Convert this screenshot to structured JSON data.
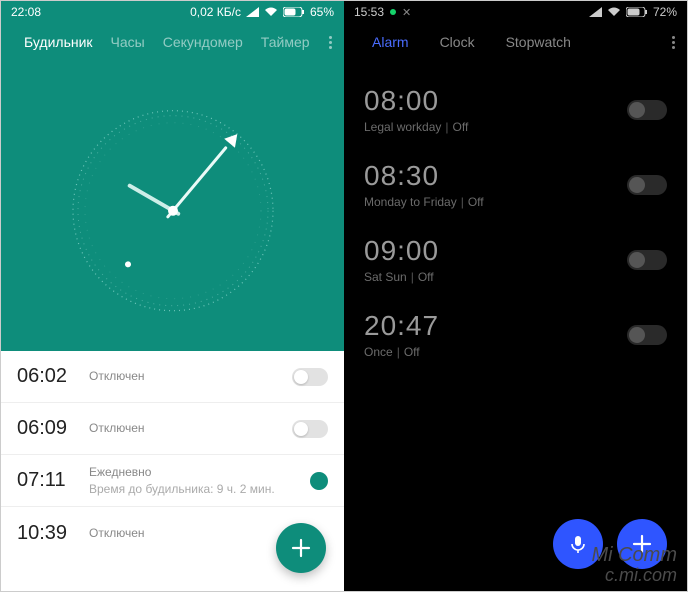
{
  "left": {
    "status": {
      "time": "22:08",
      "speed": "0,02 КБ/с",
      "battery": "65%"
    },
    "tabs": [
      "Будильник",
      "Часы",
      "Секундомер",
      "Таймер"
    ],
    "active_tab_index": 0,
    "alarms": [
      {
        "time": "06:02",
        "label": "Отключен",
        "sub": "",
        "on": false,
        "toggle_style": "switch"
      },
      {
        "time": "06:09",
        "label": "Отключен",
        "sub": "",
        "on": false,
        "toggle_style": "switch"
      },
      {
        "time": "07:11",
        "label": "Ежедневно",
        "sub": "Время до будильника: 9 ч. 2 мин.",
        "on": true,
        "toggle_style": "radio"
      },
      {
        "time": "10:39",
        "label": "Отключен",
        "sub": "",
        "on": false,
        "toggle_style": "none"
      }
    ]
  },
  "right": {
    "status": {
      "time": "15:53",
      "battery": "72%"
    },
    "tabs": [
      "Alarm",
      "Clock",
      "Stopwatch"
    ],
    "active_tab_index": 0,
    "alarms": [
      {
        "time": "08:00",
        "desc": "Legal workday",
        "state": "Off"
      },
      {
        "time": "08:30",
        "desc": "Monday to Friday",
        "state": "Off"
      },
      {
        "time": "09:00",
        "desc": "Sat Sun",
        "state": "Off"
      },
      {
        "time": "20:47",
        "desc": "Once",
        "state": "Off"
      }
    ],
    "watermark": {
      "line1": "Mi Comm",
      "line2": "c.mi.com"
    }
  }
}
